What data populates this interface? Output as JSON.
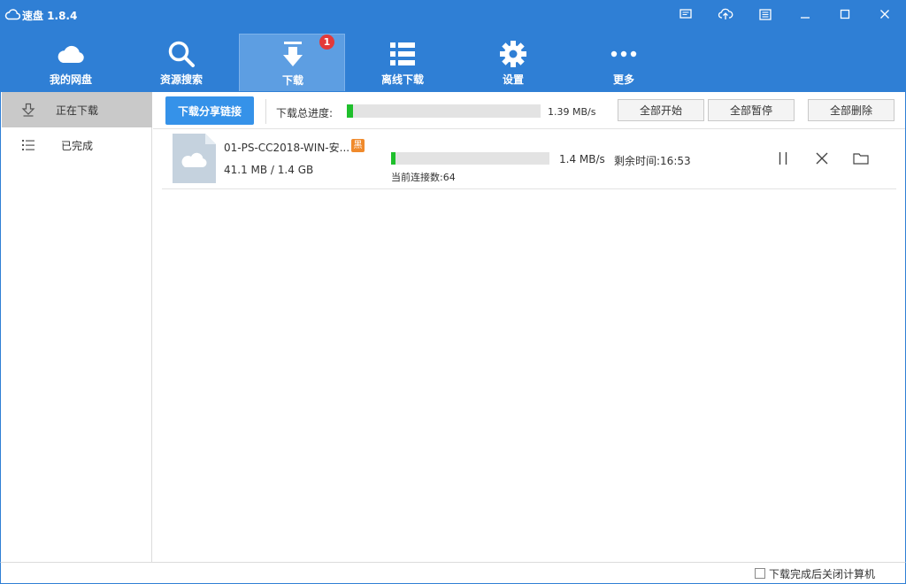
{
  "app": {
    "title": "速盘 1.8.4"
  },
  "nav": {
    "items": [
      {
        "label": "我的网盘",
        "icon": "cloud-icon"
      },
      {
        "label": "资源搜索",
        "icon": "search-icon"
      },
      {
        "label": "下载",
        "icon": "download-icon",
        "active": true,
        "badge": "1"
      },
      {
        "label": "离线下载",
        "icon": "list-icon"
      },
      {
        "label": "设置",
        "icon": "gear-icon"
      },
      {
        "label": "更多",
        "icon": "more-icon"
      }
    ]
  },
  "sidebar": {
    "items": [
      {
        "label": "正在下载",
        "icon": "download-arrow-icon",
        "active": true
      },
      {
        "label": "已完成",
        "icon": "list-icon"
      }
    ]
  },
  "toolbar": {
    "share_label": "下载分享链接",
    "total_progress_label": "下载总进度:",
    "total_progress_fraction": 0.03,
    "total_speed": "1.39 MB/s",
    "start_all": "全部开始",
    "pause_all": "全部暂停",
    "delete_all": "全部删除"
  },
  "downloads": [
    {
      "name": "01-PS-CC2018-WIN-安...",
      "tag": "黑",
      "size": "41.1 MB / 1.4 GB",
      "progress_fraction": 0.03,
      "speed": "1.4 MB/s",
      "remaining": "剩余时间:16:53",
      "connections": "当前连接数:64"
    }
  ],
  "footer": {
    "shutdown_label": "下载完成后关闭计算机",
    "shutdown_checked": false
  },
  "colors": {
    "brand_blue": "#2f7fd5",
    "progress_green": "#1fbf2c",
    "badge_red": "#e33a3a",
    "tag_orange": "#f08a2c"
  }
}
